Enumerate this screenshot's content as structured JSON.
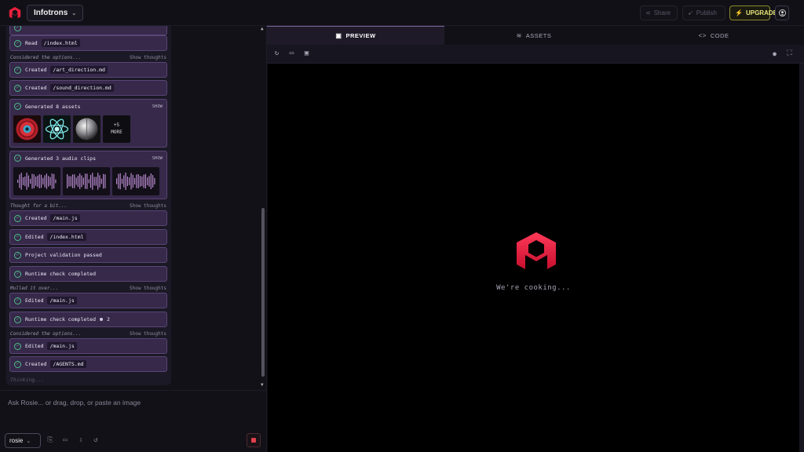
{
  "header": {
    "project_name": "Infotrons",
    "share_label": "Share",
    "publish_label": "Publish",
    "upgrade_label": "UPGRADE"
  },
  "chat": {
    "steps": [
      {
        "verb": "Read",
        "file": "/index.html"
      },
      {
        "verb": "Created",
        "file": "/art_direction.md"
      },
      {
        "verb": "Created",
        "file": "/sound_direction.md"
      },
      {
        "verb": "Created",
        "file": "/main.js"
      },
      {
        "verb": "Edited",
        "file": "/index.html"
      },
      {
        "verb": "Project validation passed",
        "file": ""
      },
      {
        "verb": "Runtime check completed",
        "file": ""
      },
      {
        "verb": "Edited",
        "file": "/main.js"
      },
      {
        "verb": "Runtime check completed",
        "file": "",
        "count": "2"
      },
      {
        "verb": "Edited",
        "file": "/main.js"
      },
      {
        "verb": "Created",
        "file": "/AGENTS.md"
      }
    ],
    "thoughts": [
      {
        "text": "Considered the options...",
        "link": "Show thoughts"
      },
      {
        "text": "Thought for a bit...",
        "link": "Show thoughts"
      },
      {
        "text": "Mulled it over...",
        "link": "Show thoughts"
      },
      {
        "text": "Considered the options...",
        "link": "Show thoughts"
      }
    ],
    "assets_card": {
      "title": "Generated 8 assets",
      "show": "SHOW",
      "more_count": "+5",
      "more_label": "MORE"
    },
    "audio_card": {
      "title": "Generated 3 audio clips",
      "show": "SHOW"
    },
    "thinking": "Thinking..."
  },
  "input": {
    "placeholder": "Ask Rosie... or drag, drop, or paste an image",
    "model": "rosie"
  },
  "preview": {
    "tabs": [
      "PREVIEW",
      "ASSETS",
      "CODE"
    ],
    "loading_text": "We're cooking..."
  },
  "colors": {
    "accent_purple": "#36294a",
    "success_green": "#4ec08a",
    "brand_red": "#e8203c",
    "upgrade_yellow": "#e8e47a"
  }
}
